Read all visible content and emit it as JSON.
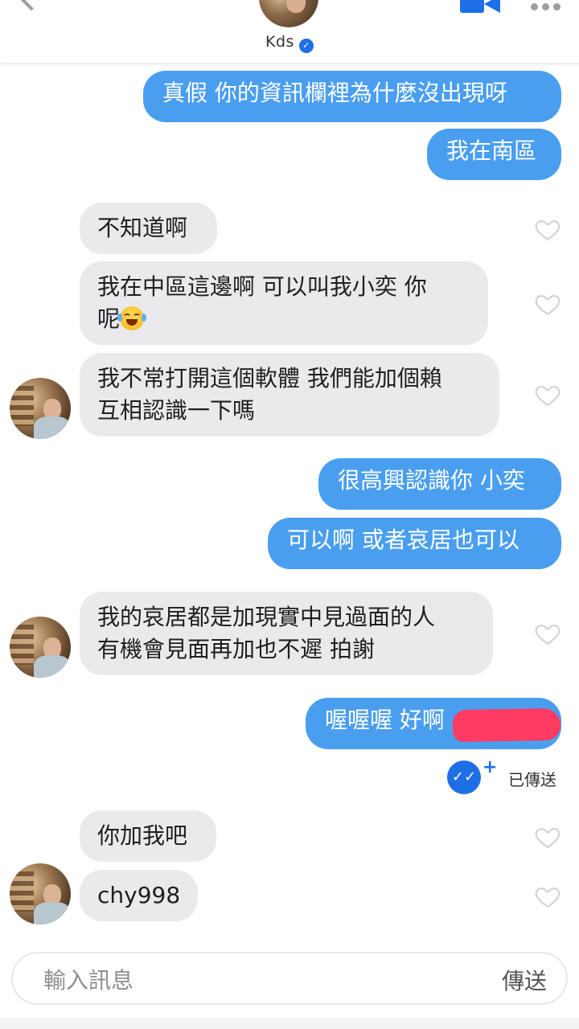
{
  "header": {
    "contact_name": "Kds",
    "verified": true
  },
  "messages": {
    "m1": "真假 你的資訊欄裡為什麼沒出現呀",
    "m2": "我在南區",
    "m3": "不知道啊",
    "m4_l1": "我在中區這邊啊 可以叫我小奕  你",
    "m4_l2": "呢",
    "m5_l1": "我不常打開這個軟體 我們能加個賴",
    "m5_l2": "互相認識一下嗎",
    "m6": "很高興認識你 小奕",
    "m7": "可以啊 或者哀居也可以",
    "m8_l1": "我的哀居都是加現實中見過面的人",
    "m8_l2": "有機會見面再加也不遲 拍謝",
    "m9": "喔喔喔 好啊",
    "m10": "你加我吧",
    "m11": "chy998"
  },
  "read_receipt": {
    "status": "已傳送"
  },
  "composer": {
    "placeholder": "輸入訊息",
    "send_label": "傳送"
  },
  "colors": {
    "sent_bubble": "#4a9ef0",
    "received_bubble": "#eaeaec",
    "accent": "#1e6ee8",
    "redaction": "#ff3b63"
  },
  "icons": [
    "back-chevron-icon",
    "verified-badge-icon",
    "video-call-icon",
    "more-options-icon",
    "heart-icon",
    "laughing-tears-emoji-icon",
    "read-receipt-icon"
  ]
}
